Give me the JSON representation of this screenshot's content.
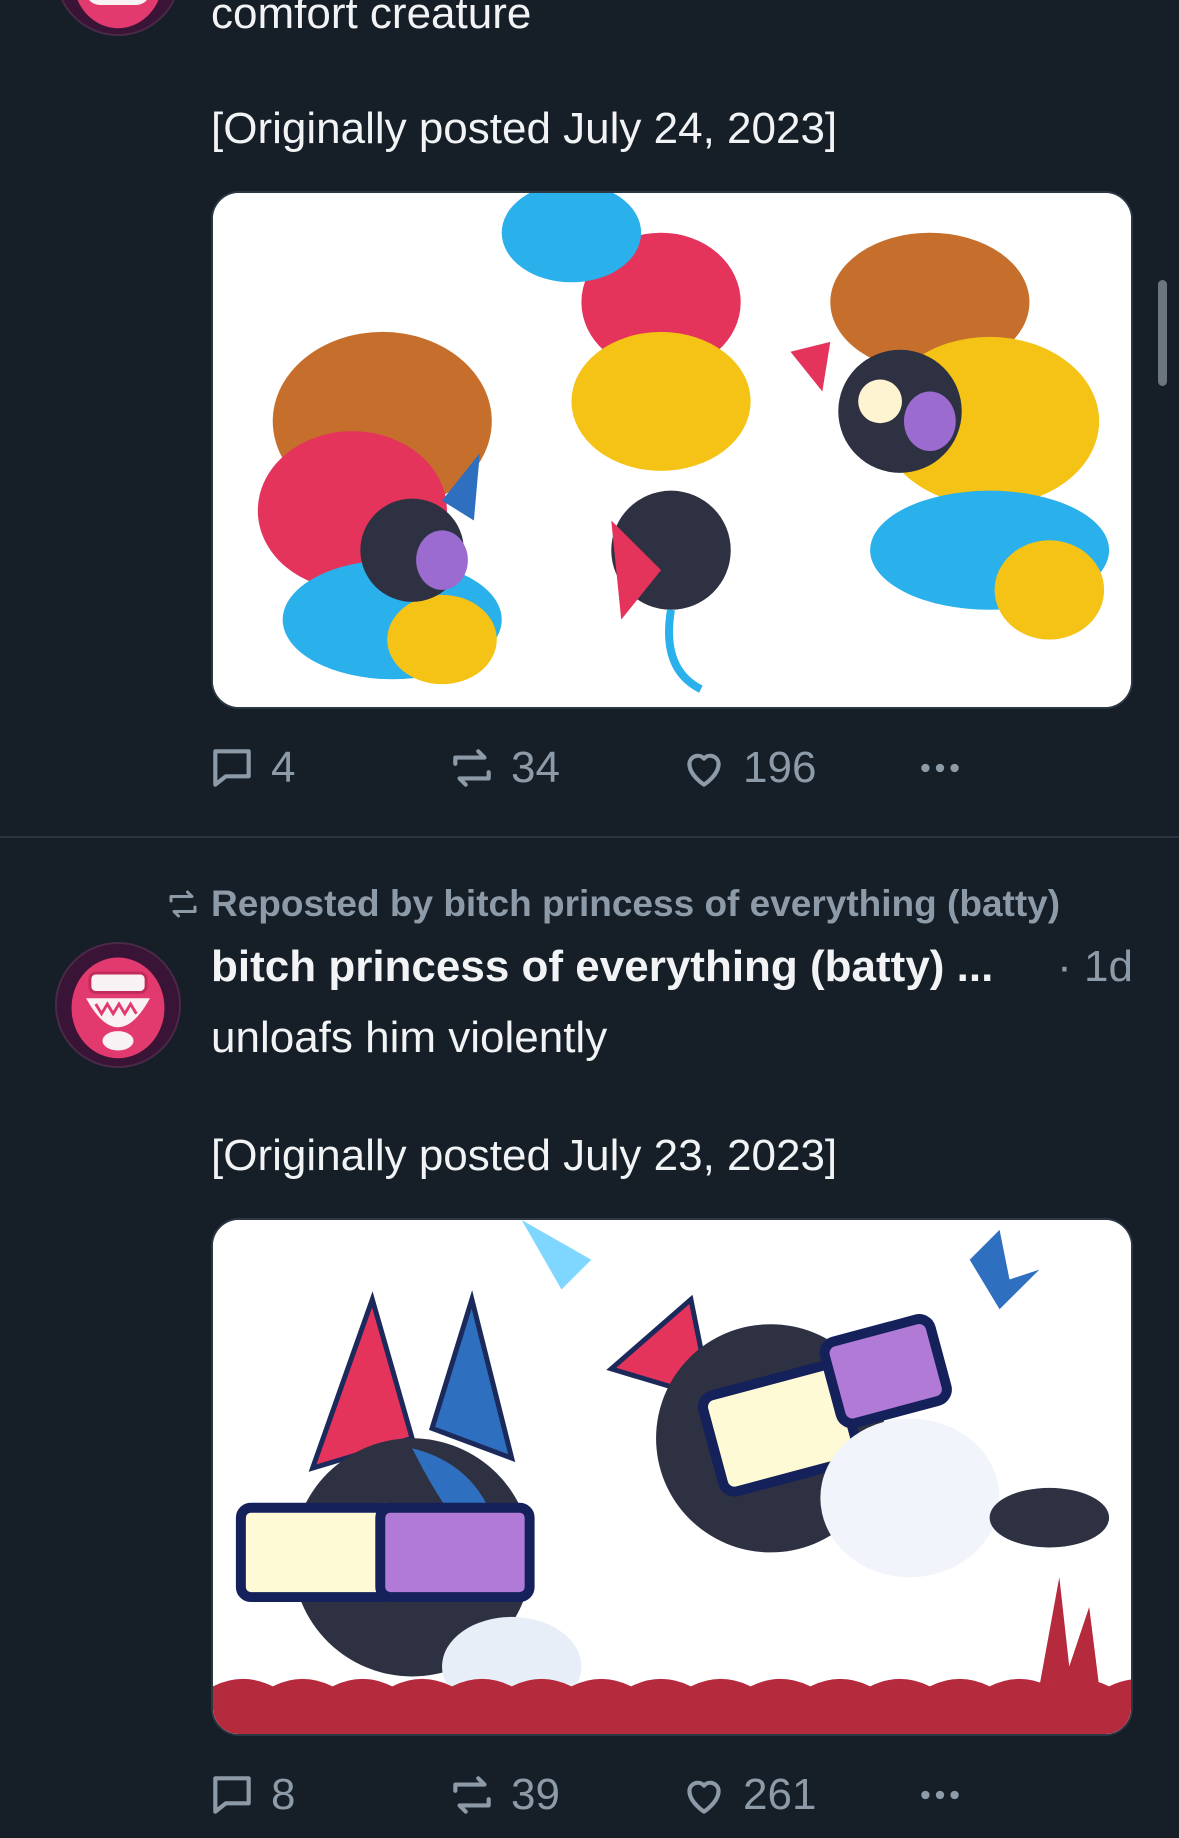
{
  "post1": {
    "text_tail": "comfort creature",
    "original_note": "[Originally posted July 24, 2023]",
    "image_alt": "Artwork: cartoon creatures napping in three loaf-like piles with small black cat creatures",
    "counts": {
      "replies": "4",
      "reposts": "34",
      "likes": "196"
    }
  },
  "post2": {
    "repost_label": "Reposted by bitch princess of everything (batty)",
    "author": "bitch princess of everything (batty) ...",
    "time": "· 1d",
    "text": "unloafs him violently",
    "original_note": "[Originally posted July 23, 2023]",
    "image_alt": "Artwork: two black cat creatures with big glasses, one kicking the other violently",
    "counts": {
      "replies": "8",
      "reposts": "39",
      "likes": "261"
    }
  },
  "icons": {
    "reply": "reply-bubble-icon",
    "repost": "repost-arrows-icon",
    "like": "heart-icon",
    "more": "more-dots-icon"
  },
  "colors": {
    "background": "#161e27",
    "text": "#f1f3f5",
    "muted": "#8d9aa8",
    "divider": "#2a3440"
  }
}
